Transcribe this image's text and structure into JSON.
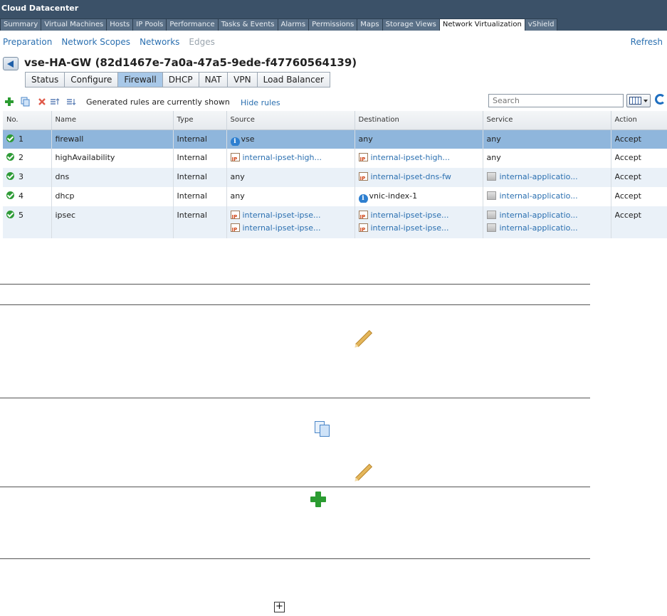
{
  "app": {
    "title": "Cloud Datacenter"
  },
  "main_tabs": [
    {
      "label": "Summary"
    },
    {
      "label": "Virtual Machines"
    },
    {
      "label": "Hosts"
    },
    {
      "label": "IP Pools"
    },
    {
      "label": "Performance"
    },
    {
      "label": "Tasks & Events"
    },
    {
      "label": "Alarms"
    },
    {
      "label": "Permissions"
    },
    {
      "label": "Maps"
    },
    {
      "label": "Storage Views"
    },
    {
      "label": "Network Virtualization",
      "active": true
    },
    {
      "label": "vShield"
    }
  ],
  "subnav": {
    "items": [
      "Preparation",
      "Network Scopes",
      "Networks",
      "Edges"
    ],
    "refresh": "Refresh"
  },
  "edge": {
    "title": "vse-HA-GW (82d1467e-7a0a-47a5-9ede-f47760564139)"
  },
  "edge_tabs": [
    "Status",
    "Configure",
    "Firewall",
    "DHCP",
    "NAT",
    "VPN",
    "Load Balancer"
  ],
  "toolbar": {
    "generated_text": "Generated rules are currently shown",
    "hide_rules": "Hide rules",
    "search_placeholder": "Search"
  },
  "table": {
    "columns": [
      "No.",
      "Name",
      "Type",
      "Source",
      "Destination",
      "Service",
      "Action"
    ],
    "rows": [
      {
        "no": "1",
        "name": "firewall",
        "type": "Internal",
        "source": [
          {
            "text": "vse",
            "icon": "info-icon"
          }
        ],
        "destination": [
          {
            "text": "any"
          }
        ],
        "service": [
          {
            "text": "any"
          }
        ],
        "action": "Accept"
      },
      {
        "no": "2",
        "name": "highAvailability",
        "type": "Internal",
        "source": [
          {
            "text": "internal-ipset-high...",
            "icon": "ipset-icon"
          }
        ],
        "destination": [
          {
            "text": "internal-ipset-high...",
            "icon": "ipset-icon"
          }
        ],
        "service": [
          {
            "text": "any"
          }
        ],
        "action": "Accept"
      },
      {
        "no": "3",
        "name": "dns",
        "type": "Internal",
        "source": [
          {
            "text": "any"
          }
        ],
        "destination": [
          {
            "text": "internal-ipset-dns-fw",
            "icon": "ipset-icon"
          }
        ],
        "service": [
          {
            "text": "internal-applicatio...",
            "icon": "service-icon"
          }
        ],
        "action": "Accept"
      },
      {
        "no": "4",
        "name": "dhcp",
        "type": "Internal",
        "source": [
          {
            "text": "any"
          }
        ],
        "destination": [
          {
            "text": "vnic-index-1",
            "icon": "info-icon"
          }
        ],
        "service": [
          {
            "text": "internal-applicatio...",
            "icon": "service-icon"
          }
        ],
        "action": "Accept"
      },
      {
        "no": "5",
        "name": "ipsec",
        "type": "Internal",
        "source": [
          {
            "text": "internal-ipset-ipse...",
            "icon": "ipset-icon"
          },
          {
            "text": "internal-ipset-ipse...",
            "icon": "ipset-icon"
          }
        ],
        "destination": [
          {
            "text": "internal-ipset-ipse...",
            "icon": "ipset-icon"
          },
          {
            "text": "internal-ipset-ipse...",
            "icon": "ipset-icon"
          }
        ],
        "service": [
          {
            "text": "internal-applicatio...",
            "icon": "service-icon"
          },
          {
            "text": "internal-applicatio...",
            "icon": "service-icon"
          }
        ],
        "action": "Accept"
      }
    ]
  },
  "colors": {
    "header_bar": "#3b5168",
    "link": "#2a6fb0",
    "selected_row": "#8fb6dc",
    "accept_icon": "#2e9b37"
  }
}
